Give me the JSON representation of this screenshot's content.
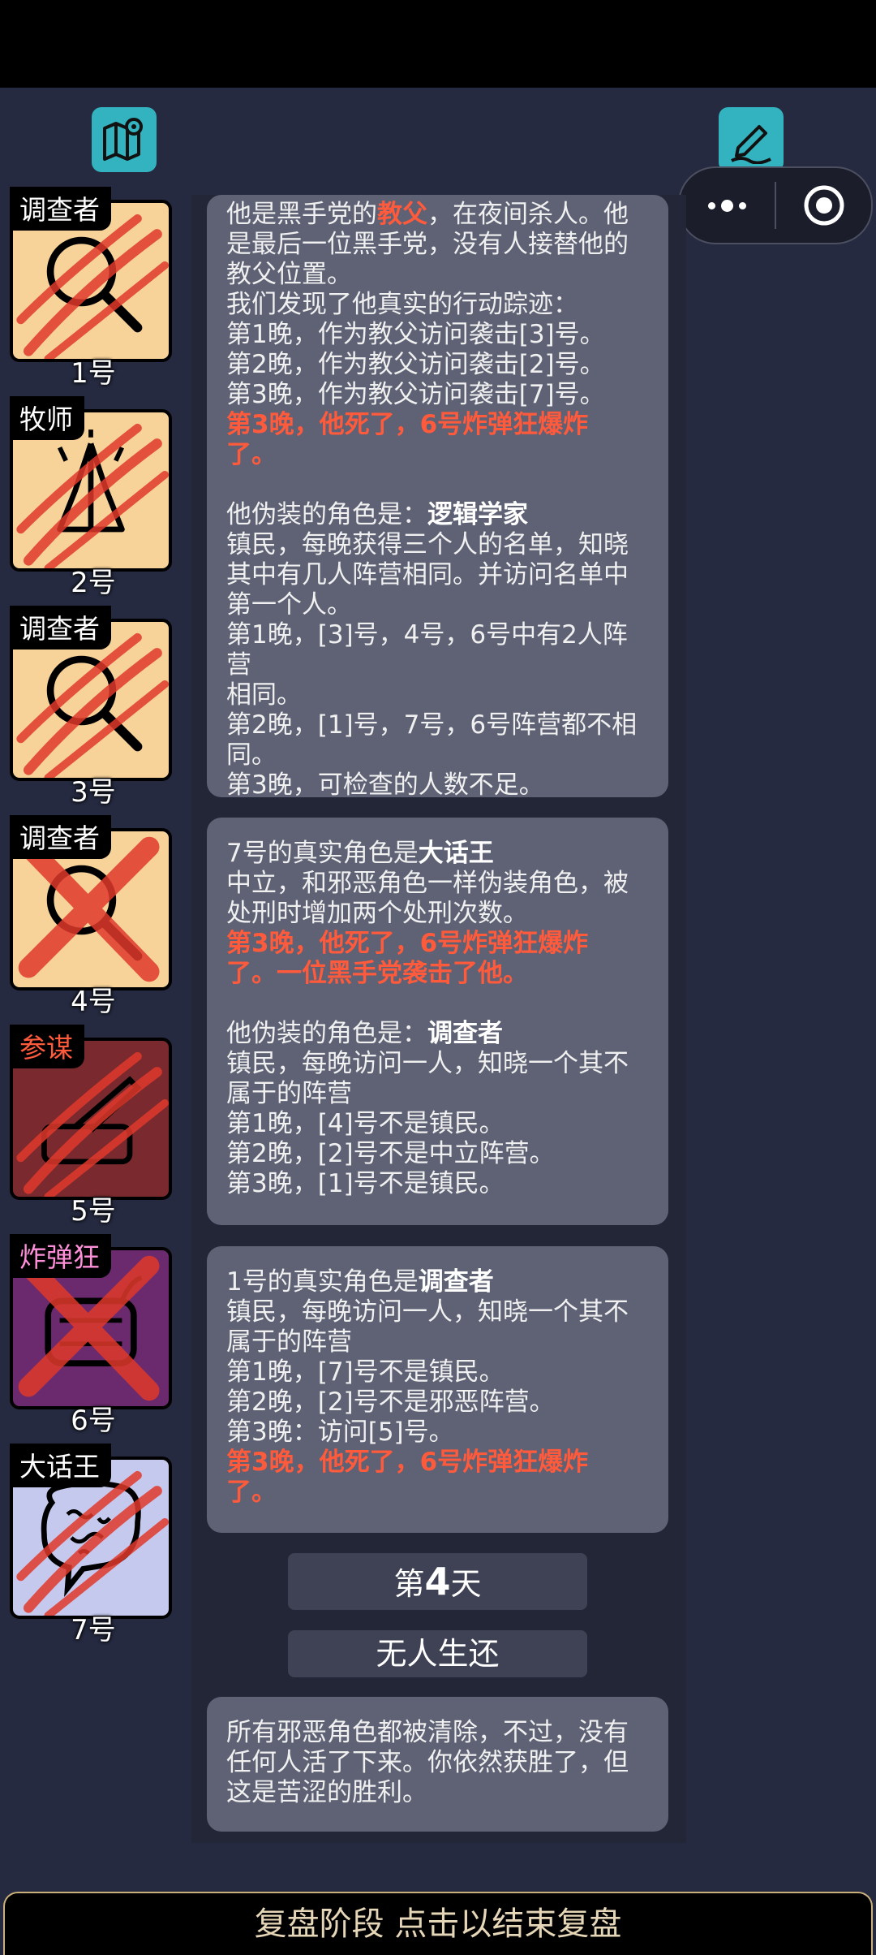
{
  "header": {
    "map_icon": "map-pin-icon",
    "edit_icon": "pencil-icon",
    "capsule": {
      "more_icon": "more-dots-icon",
      "close_icon": "target-icon"
    }
  },
  "players": [
    {
      "role": "调查者",
      "number": "1号",
      "tag_color": "#ffffff",
      "card_bg": "#f8d399",
      "icon": "magnifier-icon",
      "state": "clawed"
    },
    {
      "role": "牧师",
      "number": "2号",
      "tag_color": "#ffffff",
      "card_bg": "#f8d399",
      "icon": "praying-hands-icon",
      "state": "clawed"
    },
    {
      "role": "调查者",
      "number": "3号",
      "tag_color": "#ffffff",
      "card_bg": "#f8d399",
      "icon": "magnifier-icon",
      "state": "clawed"
    },
    {
      "role": "调查者",
      "number": "4号",
      "tag_color": "#ffffff",
      "card_bg": "#f8d399",
      "icon": "magnifier-icon",
      "state": "crossed"
    },
    {
      "role": "参谋",
      "number": "5号",
      "tag_color": "#ff5a3c",
      "card_bg": "#7a2a2e",
      "icon": "quill-icon",
      "state": "clawed"
    },
    {
      "role": "炸弹狂",
      "number": "6号",
      "tag_color": "#ff8fd8",
      "card_bg": "#6b2a6e",
      "icon": "bomb-icon",
      "state": "crossed"
    },
    {
      "role": "大话王",
      "number": "7号",
      "tag_color": "#ffffff",
      "card_bg": "#c5c9ee",
      "icon": "speech-bubble-icon",
      "state": "clawed"
    }
  ],
  "box1": {
    "l1a": "他是黑手党的",
    "l1b": "教父",
    "l1c": "，在夜间杀人。他",
    "l2": "是最后一位黑手党，没有人接替他的",
    "l3": "教父位置。",
    "l4": "我们发现了他真实的行动踪迹：",
    "l5": "第1晚，作为教父访问袭击[3]号。",
    "l6": "第2晚，作为教父访问袭击[2]号。",
    "l7": "第3晚，作为教父访问袭击[7]号。",
    "l8": "第3晚，他死了，6号炸弹狂爆炸",
    "l9": "了。",
    "l10a": "他伪装的角色是：",
    "l10b": "逻辑学家",
    "l11": "镇民，每晚获得三个人的名单，知晓",
    "l12": "其中有几人阵营相同。并访问名单中",
    "l13": "第一个人。",
    "l14": "第1晚，[3]号，4号，6号中有2人阵营",
    "l15": "相同。",
    "l16": "第2晚，[1]号，7号，6号阵营都不相",
    "l17": "同。",
    "l18": "第3晚，可检查的人数不足。"
  },
  "box2": {
    "l1a": "7号的真实角色是",
    "l1b": "大话王",
    "l2": "中立，和邪恶角色一样伪装角色，被",
    "l3": "处刑时增加两个处刑次数。",
    "l4": "第3晚，他死了，6号炸弹狂爆炸",
    "l5": "了。一位黑手党袭击了他。",
    "l6a": "他伪装的角色是：",
    "l6b": "调查者",
    "l7": "镇民，每晚访问一人，知晓一个其不",
    "l8": "属于的阵营",
    "l9": "第1晚，[4]号不是镇民。",
    "l10": "第2晚，[2]号不是中立阵营。",
    "l11": "第3晚，[1]号不是镇民。"
  },
  "box3": {
    "l1a": "1号的真实角色是",
    "l1b": "调查者",
    "l2": "镇民，每晚访问一人，知晓一个其不",
    "l3": "属于的阵营",
    "l4": "第1晚，[7]号不是镇民。",
    "l5": "第2晚，[2]号不是邪恶阵营。",
    "l6": "第3晚：访问[5]号。",
    "l7": "第3晚，他死了，6号炸弹狂爆炸",
    "l8": "了。"
  },
  "day": {
    "prefix": "第",
    "number": "4",
    "suffix": "天"
  },
  "result_title": "无人生还",
  "box4": {
    "l1": "所有邪恶角色都被清除，不过，没有",
    "l2": "任何人活了下来。你依然获胜了，但",
    "l3": "这是苦涩的胜利。"
  },
  "footer": {
    "label": "复盘阶段 点击以结束复盘"
  }
}
